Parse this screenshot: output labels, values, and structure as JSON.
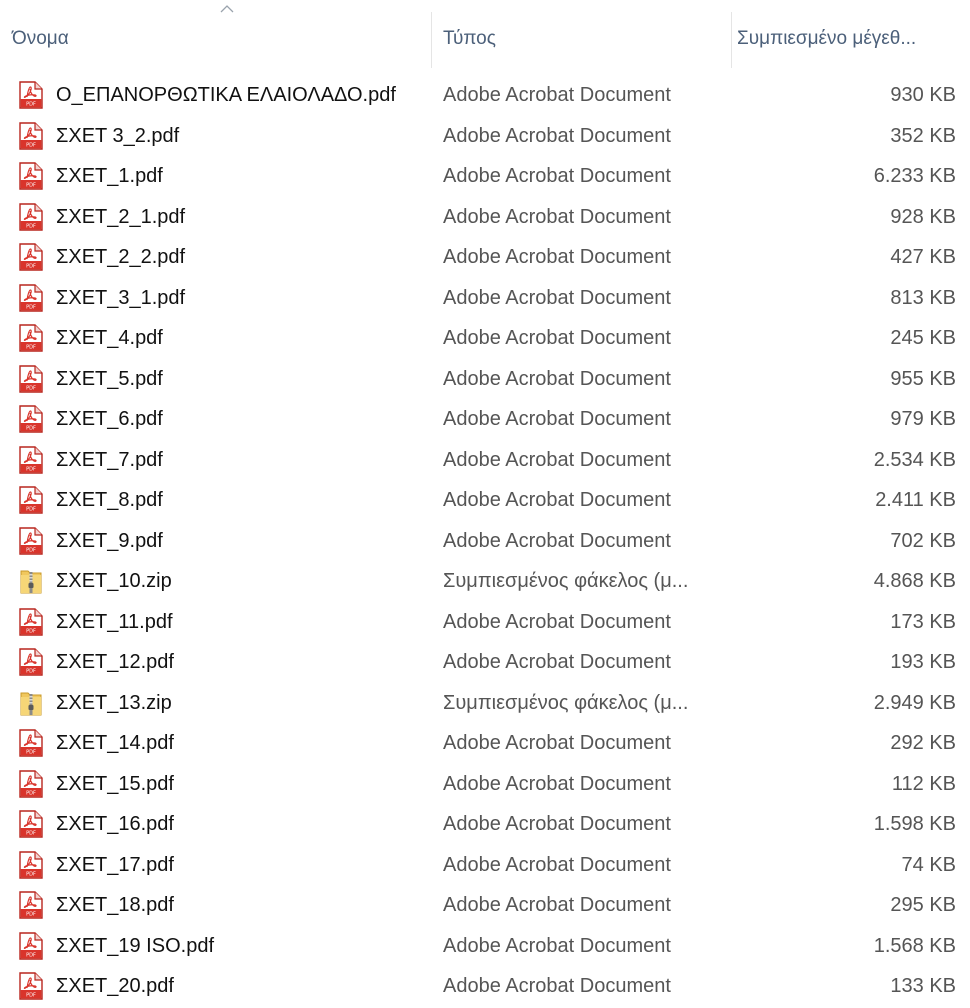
{
  "columns": {
    "name": "Όνομα",
    "type": "Τύπος",
    "size": "Συμπιεσμένο μέγεθ..."
  },
  "icons": {
    "sort": "sort-ascending-chevron-icon",
    "pdf": "pdf-file-icon",
    "zip": "zip-folder-icon"
  },
  "colors": {
    "pdf_red": "#d9342b",
    "zip_yellow": "#e8c25a"
  },
  "files": [
    {
      "name": "Ο_ΕΠΑΝΟΡΘΩΤΙΚΑ ΕΛΑΙΟΛΑΔΟ.pdf",
      "type": "Adobe Acrobat Document",
      "size": "930 KB",
      "icon": "pdf"
    },
    {
      "name": "ΣΧΕΤ 3_2.pdf",
      "type": "Adobe Acrobat Document",
      "size": "352 KB",
      "icon": "pdf"
    },
    {
      "name": "ΣΧΕΤ_1.pdf",
      "type": "Adobe Acrobat Document",
      "size": "6.233 KB",
      "icon": "pdf"
    },
    {
      "name": "ΣΧΕΤ_2_1.pdf",
      "type": "Adobe Acrobat Document",
      "size": "928 KB",
      "icon": "pdf"
    },
    {
      "name": "ΣΧΕΤ_2_2.pdf",
      "type": "Adobe Acrobat Document",
      "size": "427 KB",
      "icon": "pdf"
    },
    {
      "name": "ΣΧΕΤ_3_1.pdf",
      "type": "Adobe Acrobat Document",
      "size": "813 KB",
      "icon": "pdf"
    },
    {
      "name": "ΣΧΕΤ_4.pdf",
      "type": "Adobe Acrobat Document",
      "size": "245 KB",
      "icon": "pdf"
    },
    {
      "name": "ΣΧΕΤ_5.pdf",
      "type": "Adobe Acrobat Document",
      "size": "955 KB",
      "icon": "pdf"
    },
    {
      "name": "ΣΧΕΤ_6.pdf",
      "type": "Adobe Acrobat Document",
      "size": "979 KB",
      "icon": "pdf"
    },
    {
      "name": "ΣΧΕΤ_7.pdf",
      "type": "Adobe Acrobat Document",
      "size": "2.534 KB",
      "icon": "pdf"
    },
    {
      "name": "ΣΧΕΤ_8.pdf",
      "type": "Adobe Acrobat Document",
      "size": "2.411 KB",
      "icon": "pdf"
    },
    {
      "name": "ΣΧΕΤ_9.pdf",
      "type": "Adobe Acrobat Document",
      "size": "702 KB",
      "icon": "pdf"
    },
    {
      "name": "ΣΧΕΤ_10.zip",
      "type": "Συμπιεσμένος φάκελος (μ...",
      "size": "4.868 KB",
      "icon": "zip"
    },
    {
      "name": "ΣΧΕΤ_11.pdf",
      "type": "Adobe Acrobat Document",
      "size": "173 KB",
      "icon": "pdf"
    },
    {
      "name": "ΣΧΕΤ_12.pdf",
      "type": "Adobe Acrobat Document",
      "size": "193 KB",
      "icon": "pdf"
    },
    {
      "name": "ΣΧΕΤ_13.zip",
      "type": "Συμπιεσμένος φάκελος (μ...",
      "size": "2.949 KB",
      "icon": "zip"
    },
    {
      "name": "ΣΧΕΤ_14.pdf",
      "type": "Adobe Acrobat Document",
      "size": "292 KB",
      "icon": "pdf"
    },
    {
      "name": "ΣΧΕΤ_15.pdf",
      "type": "Adobe Acrobat Document",
      "size": "112 KB",
      "icon": "pdf"
    },
    {
      "name": "ΣΧΕΤ_16.pdf",
      "type": "Adobe Acrobat Document",
      "size": "1.598 KB",
      "icon": "pdf"
    },
    {
      "name": "ΣΧΕΤ_17.pdf",
      "type": "Adobe Acrobat Document",
      "size": "74 KB",
      "icon": "pdf"
    },
    {
      "name": "ΣΧΕΤ_18.pdf",
      "type": "Adobe Acrobat Document",
      "size": "295 KB",
      "icon": "pdf"
    },
    {
      "name": "ΣΧΕΤ_19 ISO.pdf",
      "type": "Adobe Acrobat Document",
      "size": "1.568 KB",
      "icon": "pdf"
    },
    {
      "name": "ΣΧΕΤ_20.pdf",
      "type": "Adobe Acrobat Document",
      "size": "133 KB",
      "icon": "pdf"
    }
  ]
}
